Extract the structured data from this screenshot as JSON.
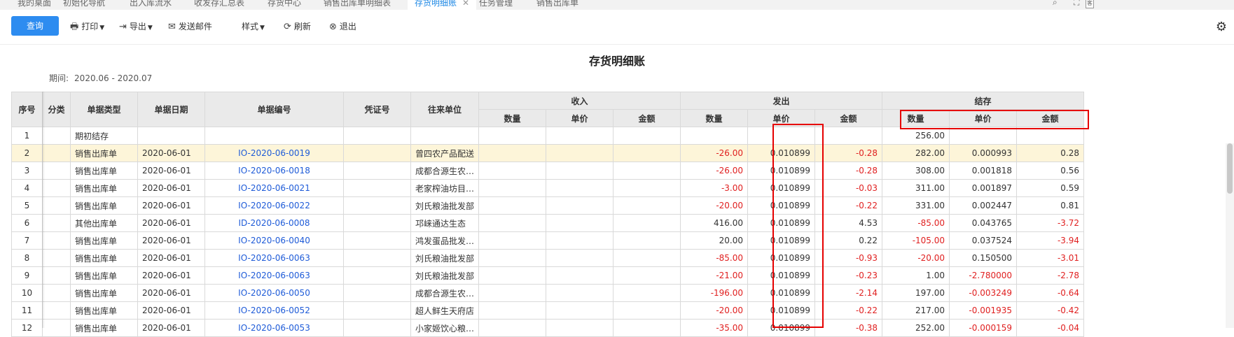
{
  "tabs": [
    {
      "label": "我的桌面"
    },
    {
      "label": "初始化导航"
    },
    {
      "label": "出入库流水"
    },
    {
      "label": "收发存汇总表"
    },
    {
      "label": "存货中心"
    },
    {
      "label": "销售出库单明细表"
    },
    {
      "label": "存货明细账",
      "active": true
    },
    {
      "label": "任务管理"
    },
    {
      "label": "销售出库单"
    }
  ],
  "tab_close": "✕",
  "side_badge": "客",
  "toolbar": {
    "query": "查询",
    "print": "打印",
    "export": "导出",
    "email": "发送邮件",
    "style": "样式",
    "refresh": "刷新",
    "exit": "退出"
  },
  "report": {
    "title": "存货明细账",
    "period_label": "期间:",
    "period_value": "2020.06 - 2020.07"
  },
  "table": {
    "headers": {
      "seq": "序号",
      "category": "分类",
      "doc_type": "单据类型",
      "doc_date": "单据日期",
      "doc_no": "单据编号",
      "voucher": "凭证号",
      "partner": "往来单位",
      "income": "收入",
      "outgo": "发出",
      "balance": "结存",
      "qty": "数量",
      "price": "单价",
      "amount": "金额"
    },
    "rows": [
      {
        "seq": "1",
        "type": "期初结存",
        "date": "",
        "no": "",
        "voucher": "",
        "partner": "",
        "in_qty": "",
        "in_price": "",
        "in_amt": "",
        "out_qty": "",
        "out_price": "",
        "out_amt": "",
        "bal_qty": "256.00",
        "bal_price": "",
        "bal_amt": ""
      },
      {
        "seq": "2",
        "type": "销售出库单",
        "date": "2020-06-01",
        "no": "IO-2020-06-0019",
        "voucher": "",
        "partner": "曾四农产品配送",
        "in_qty": "",
        "in_price": "",
        "in_amt": "",
        "out_qty": "-26.00",
        "out_price": "0.010899",
        "out_amt": "-0.28",
        "bal_qty": "282.00",
        "bal_price": "0.000993",
        "bal_amt": "0.28"
      },
      {
        "seq": "3",
        "type": "销售出库单",
        "date": "2020-06-01",
        "no": "IO-2020-06-0018",
        "voucher": "",
        "partner": "成都合源生农…",
        "in_qty": "",
        "in_price": "",
        "in_amt": "",
        "out_qty": "-26.00",
        "out_price": "0.010899",
        "out_amt": "-0.28",
        "bal_qty": "308.00",
        "bal_price": "0.001818",
        "bal_amt": "0.56"
      },
      {
        "seq": "4",
        "type": "销售出库单",
        "date": "2020-06-01",
        "no": "IO-2020-06-0021",
        "voucher": "",
        "partner": "老家榨油坊目…",
        "in_qty": "",
        "in_price": "",
        "in_amt": "",
        "out_qty": "-3.00",
        "out_price": "0.010899",
        "out_amt": "-0.03",
        "bal_qty": "311.00",
        "bal_price": "0.001897",
        "bal_amt": "0.59"
      },
      {
        "seq": "5",
        "type": "销售出库单",
        "date": "2020-06-01",
        "no": "IO-2020-06-0022",
        "voucher": "",
        "partner": "刘氏粮油批发部",
        "in_qty": "",
        "in_price": "",
        "in_amt": "",
        "out_qty": "-20.00",
        "out_price": "0.010899",
        "out_amt": "-0.22",
        "bal_qty": "331.00",
        "bal_price": "0.002447",
        "bal_amt": "0.81"
      },
      {
        "seq": "6",
        "type": "其他出库单",
        "date": "2020-06-01",
        "no": "ID-2020-06-0008",
        "voucher": "",
        "partner": "邛崃通达生态",
        "in_qty": "",
        "in_price": "",
        "in_amt": "",
        "out_qty": "416.00",
        "out_price": "0.010899",
        "out_amt": "4.53",
        "bal_qty": "-85.00",
        "bal_price": "0.043765",
        "bal_amt": "-3.72"
      },
      {
        "seq": "7",
        "type": "销售出库单",
        "date": "2020-06-01",
        "no": "IO-2020-06-0040",
        "voucher": "",
        "partner": "鸿发蛋品批发…",
        "in_qty": "",
        "in_price": "",
        "in_amt": "",
        "out_qty": "20.00",
        "out_price": "0.010899",
        "out_amt": "0.22",
        "bal_qty": "-105.00",
        "bal_price": "0.037524",
        "bal_amt": "-3.94"
      },
      {
        "seq": "8",
        "type": "销售出库单",
        "date": "2020-06-01",
        "no": "IO-2020-06-0063",
        "voucher": "",
        "partner": "刘氏粮油批发部",
        "in_qty": "",
        "in_price": "",
        "in_amt": "",
        "out_qty": "-85.00",
        "out_price": "0.010899",
        "out_amt": "-0.93",
        "bal_qty": "-20.00",
        "bal_price": "0.150500",
        "bal_amt": "-3.01"
      },
      {
        "seq": "9",
        "type": "销售出库单",
        "date": "2020-06-01",
        "no": "IO-2020-06-0063",
        "voucher": "",
        "partner": "刘氏粮油批发部",
        "in_qty": "",
        "in_price": "",
        "in_amt": "",
        "out_qty": "-21.00",
        "out_price": "0.010899",
        "out_amt": "-0.23",
        "bal_qty": "1.00",
        "bal_price": "-2.780000",
        "bal_amt": "-2.78"
      },
      {
        "seq": "10",
        "type": "销售出库单",
        "date": "2020-06-01",
        "no": "IO-2020-06-0050",
        "voucher": "",
        "partner": "成都合源生农…",
        "in_qty": "",
        "in_price": "",
        "in_amt": "",
        "out_qty": "-196.00",
        "out_price": "0.010899",
        "out_amt": "-2.14",
        "bal_qty": "197.00",
        "bal_price": "-0.003249",
        "bal_amt": "-0.64"
      },
      {
        "seq": "11",
        "type": "销售出库单",
        "date": "2020-06-01",
        "no": "IO-2020-06-0052",
        "voucher": "",
        "partner": "超人鲜生天府店",
        "in_qty": "",
        "in_price": "",
        "in_amt": "",
        "out_qty": "-20.00",
        "out_price": "0.010899",
        "out_amt": "-0.22",
        "bal_qty": "217.00",
        "bal_price": "-0.001935",
        "bal_amt": "-0.42"
      },
      {
        "seq": "12",
        "type": "销售出库单",
        "date": "2020-06-01",
        "no": "IO-2020-06-0053",
        "voucher": "",
        "partner": "小家姬饮心粮…",
        "in_qty": "",
        "in_price": "",
        "in_amt": "",
        "out_qty": "-35.00",
        "out_price": "0.010899",
        "out_amt": "-0.38",
        "bal_qty": "252.00",
        "bal_price": "-0.000159",
        "bal_amt": "-0.04"
      }
    ]
  }
}
